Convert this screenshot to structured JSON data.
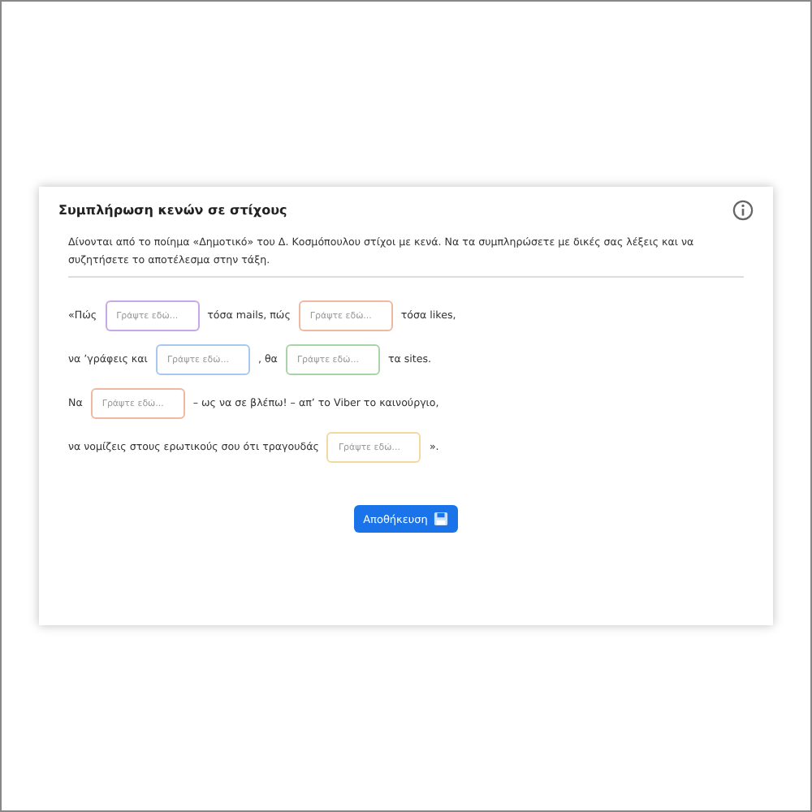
{
  "card": {
    "title": "Συμπλήρωση κενών σε στίχους",
    "instructions": "Δίνονται από το ποίημα «Δημοτικό» του Δ. Κοσμόπουλου στίχοι με κενά. Να τα συμπληρώσετε με δικές σας λέξεις και να συζητήσετε το αποτέλεσμα στην τάξη.",
    "lines": [
      [
        {
          "kind": "text",
          "text": "«Πώς"
        },
        {
          "kind": "blank",
          "placeholder": "Γράψτε εδώ...",
          "color": "#c9a6e8"
        },
        {
          "kind": "text",
          "text": "τόσα mails, πώς"
        },
        {
          "kind": "blank",
          "placeholder": "Γράψτε εδώ...",
          "color": "#f0b8a0"
        },
        {
          "kind": "text",
          "text": "τόσα likes,"
        }
      ],
      [
        {
          "kind": "text",
          "text": "να ’γράφεις και"
        },
        {
          "kind": "blank",
          "placeholder": "Γράψτε εδώ...",
          "color": "#a9c8ef"
        },
        {
          "kind": "text",
          "text": ", θα"
        },
        {
          "kind": "blank",
          "placeholder": "Γράψτε εδώ...",
          "color": "#a8d4a8"
        },
        {
          "kind": "text",
          "text": "τα sites."
        }
      ],
      [
        {
          "kind": "text",
          "text": "Να"
        },
        {
          "kind": "blank",
          "placeholder": "Γράψτε εδώ...",
          "color": "#f0b8a0"
        },
        {
          "kind": "text",
          "text": "– ως να σε βλέπω! – απ’ το Viber το καινούργιο,"
        }
      ],
      [
        {
          "kind": "text",
          "text": "να νομίζεις στους ερωτικούς σου ότι τραγουδάς"
        },
        {
          "kind": "blank",
          "placeholder": "Γράψτε εδώ...",
          "color": "#f2d9a0"
        },
        {
          "kind": "text",
          "text": "»."
        }
      ]
    ],
    "button": "Αποθήκευση"
  }
}
